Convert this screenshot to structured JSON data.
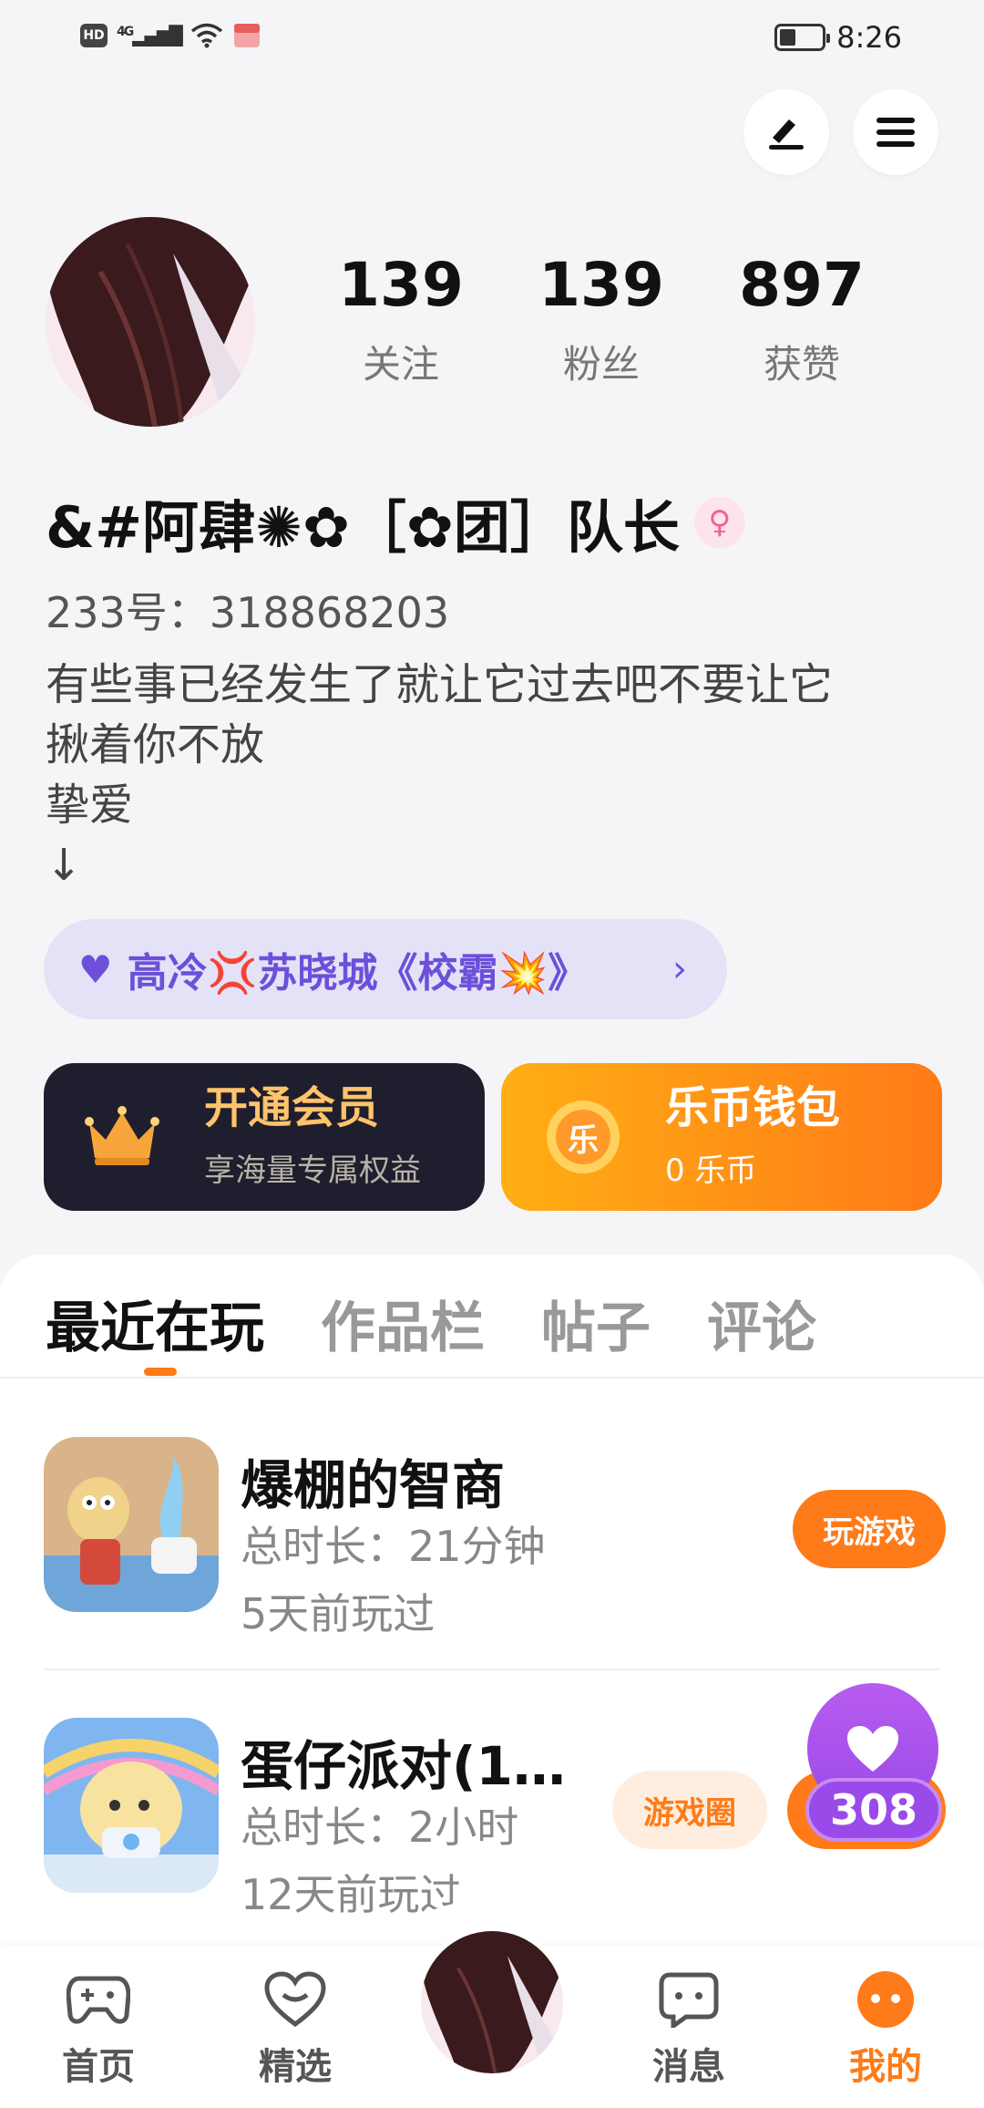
{
  "status_bar": {
    "hd": "HD",
    "network": "4G",
    "time": "8:26",
    "battery_level": 0.45
  },
  "profile": {
    "stats": [
      {
        "value": "139",
        "label": "关注"
      },
      {
        "value": "139",
        "label": "粉丝"
      },
      {
        "value": "897",
        "label": "获赞"
      }
    ],
    "username": "&#阿肆✺✿［✿团］队长",
    "gender_symbol": "♀",
    "uid": "233号：318868203",
    "bio_lines": [
      "有些事已经发生了就让它过去吧不要让它",
      "揪着你不放",
      "挚爱",
      "↓"
    ],
    "tag_text": "高冷💢苏晓城《校霸💥》",
    "tag_chevron": "›"
  },
  "cards": {
    "vip": {
      "title": "开通会员",
      "subtitle": "享海量专属权益"
    },
    "coins": {
      "title": "乐币钱包",
      "subtitle": "0 乐币",
      "icon_char": "乐"
    }
  },
  "tabs": [
    {
      "label": "最近在玩",
      "active": true
    },
    {
      "label": "作品栏",
      "active": false
    },
    {
      "label": "帖子",
      "active": false
    },
    {
      "label": "评论",
      "active": false
    }
  ],
  "games": [
    {
      "name": "爆棚的智商",
      "duration": "总时长：21分钟",
      "last_played": "5天前玩过",
      "action": "玩游戏"
    },
    {
      "name": "蛋仔派对(1…",
      "duration": "总时长：2小时",
      "last_played": "12天前玩过",
      "action": "游戏圈"
    }
  ],
  "like_float": {
    "count": "308"
  },
  "bottom_nav": [
    {
      "label": "首页",
      "icon": "gamepad-icon"
    },
    {
      "label": "精选",
      "icon": "heart-chat-icon"
    },
    {
      "label": "消息",
      "icon": "message-icon"
    },
    {
      "label": "我的",
      "icon": "mine-icon",
      "active": true
    }
  ],
  "colors": {
    "accent": "#ff7a18",
    "tag": "#6c50d9",
    "vip_gold": "#ffc36a",
    "like_purple": "#9a4ae8"
  }
}
